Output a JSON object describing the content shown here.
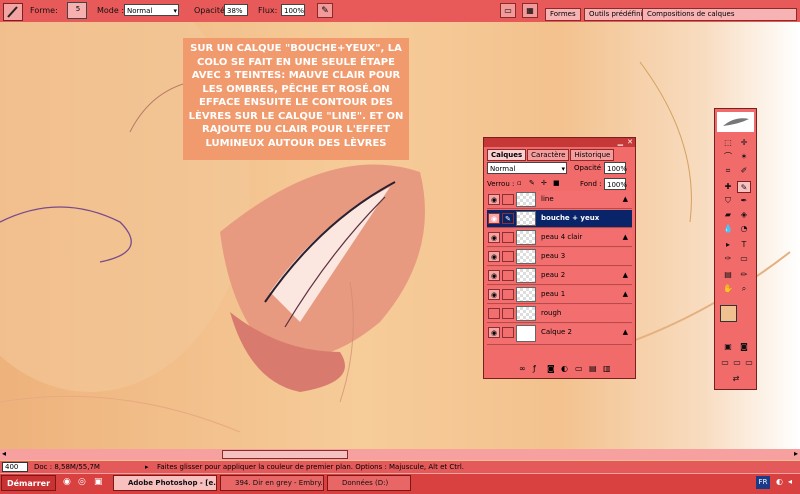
{
  "options_bar": {
    "forme_label": "Forme:",
    "brush_size": "5",
    "mode_label": "Mode :",
    "mode_value": "Normal",
    "opacite_label": "Opacité:",
    "opacite_value": "38%",
    "flux_label": "Flux:",
    "flux_value": "100%",
    "palette_tabs": [
      "Formes",
      "Outils prédéfinis",
      "Compositions de calques"
    ]
  },
  "note": "SUR UN CALQUE \"BOUCHE+YEUX\", LA COLO SE FAIT EN UNE SEULE ÉTAPE AVEC 3 TEINTES: MAUVE CLAIR POUR LES OMBRES, PÊCHE ET ROSÉ.ON EFFACE ENSUITE LE CONTOUR DES LÈVRES SUR LE CALQUE \"LINE\". ET ON RAJOUTE DU CLAIR POUR L'EFFET LUMINEUX AUTOUR DES LÈVRES",
  "layers_panel": {
    "tabs": [
      "Calques",
      "Caractère",
      "Historique"
    ],
    "blend_mode": "Normal",
    "opacite_label": "Opacité :",
    "opacite_value": "100%",
    "verrou_label": "Verrou :",
    "fond_label": "Fond :",
    "fond_value": "100%",
    "layers": [
      {
        "name": "line",
        "selected": false
      },
      {
        "name": "bouche + yeux",
        "selected": true
      },
      {
        "name": "peau 4  clair",
        "selected": false
      },
      {
        "name": "peau 3",
        "selected": false
      },
      {
        "name": "peau 2",
        "selected": false
      },
      {
        "name": "peau 1",
        "selected": false
      },
      {
        "name": "rough",
        "selected": false
      },
      {
        "name": "Calque 2",
        "selected": false
      }
    ]
  },
  "status_bar": {
    "zoom": "400 %",
    "doc": "Doc : 8,58M/55,7M",
    "hint": "Faites glisser pour appliquer la couleur de premier plan. Options : Majuscule, Alt et Ctrl."
  },
  "taskbar": {
    "start": "Démarrer",
    "tasks": [
      "Adobe Photoshop - [e...",
      "394. Dir en grey - Embry...",
      "Données (D:)"
    ],
    "lang": "FR"
  },
  "colors": {
    "accent": "#e85a5a",
    "selected_layer": "#0a246a",
    "foreground_swatch": "#f0c090",
    "note_bg": "#f09a6e"
  }
}
